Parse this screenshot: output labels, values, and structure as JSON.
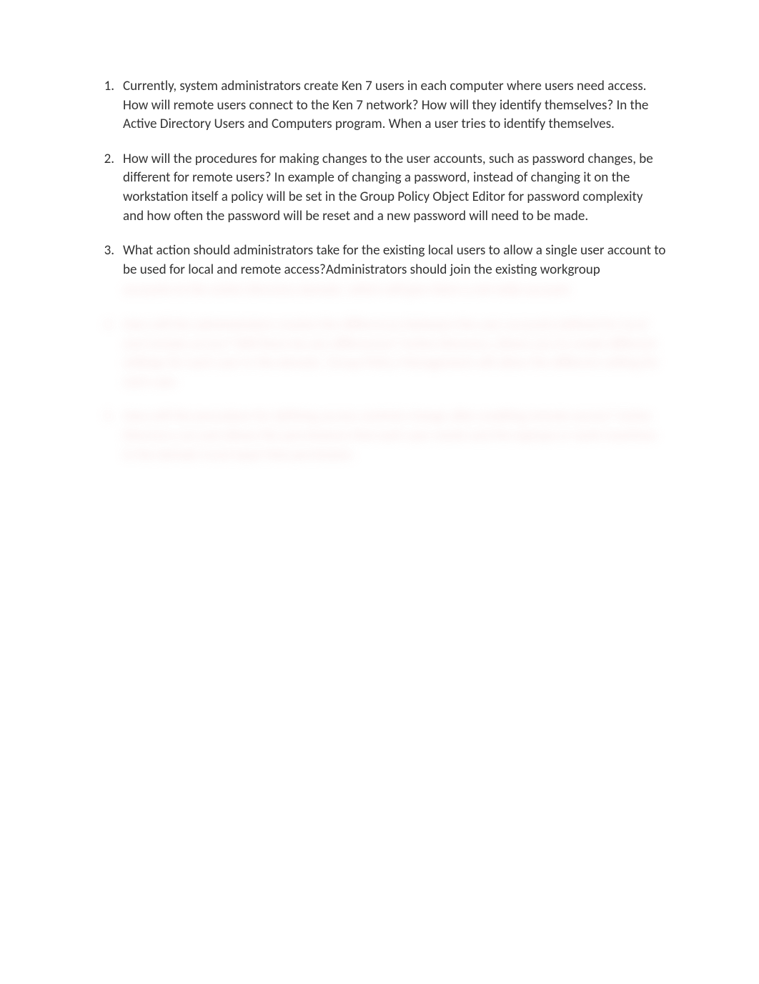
{
  "items": [
    {
      "num": "1.",
      "visible": "Currently, system administrators create Ken 7 users in each computer where users need access. How will remote users connect to the Ken 7 network? How will they identify themselves? In the Active Directory Users and Computers program. When a user tries to identify themselves.",
      "hidden_trail": ""
    },
    {
      "num": "2.",
      "visible": "How will the procedures for making changes to the user accounts, such as password changes, be different for remote users? In example of changing a password, instead of changing it on the workstation itself a policy will be set in the Group Policy Object Editor for password complexity and how often the password will be reset and a new password will need to be made.",
      "hidden_trail": ""
    },
    {
      "num": "3.",
      "visible": "What action should administrators take for the existing local users to allow a single user account to be used for local and remote access?Administrators should join the existing workgroup",
      "hidden_trail": "accounts to the active directory domain, which will give them a net-wide account."
    },
    {
      "num": "4.",
      "visible": "",
      "hidden_trail": "How will the administrators resolve the differences between the user accounts defined for local and remote access? Will there be any differences? Active Directory, allows you to create different settings for each user in the domain. Group Policy Management will allow the different setting for each user."
    },
    {
      "num": "5.",
      "visible": "",
      "hidden_trail": "How will the procedure for defining access controls change after enabling remote access? Active Directory can and allows the permissions that each user needs and the laptops or work machines in the domain must input that permission."
    }
  ]
}
